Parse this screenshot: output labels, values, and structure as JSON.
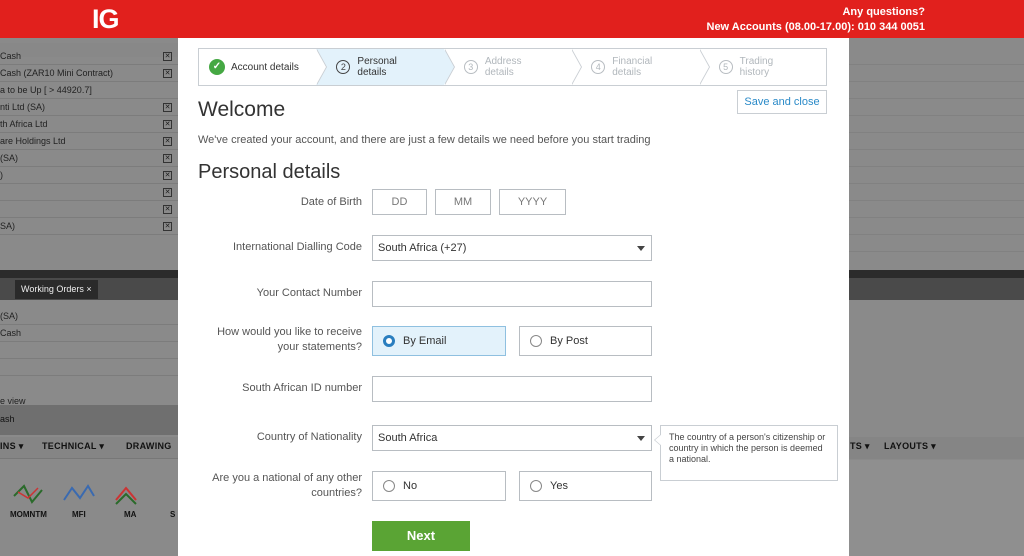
{
  "header": {
    "logo": "IG",
    "contact_line1": "Any questions?",
    "contact_line2": "New Accounts (08.00-17.00): 010 344 0051",
    "bar_color": "#e1201d"
  },
  "background": {
    "rows": [
      "Cash",
      "Cash (ZAR10 Mini Contract)",
      "a to be Up [ > 44920.7]",
      "nti Ltd (SA)",
      "th Africa Ltd",
      "are Holdings Ltd",
      "(SA)",
      ")",
      "",
      "",
      "SA)"
    ],
    "working_orders_tab": "Working Orders ×",
    "lower_rows": [
      "(SA)",
      "Cash",
      "",
      "",
      "",
      "e view"
    ],
    "chart_tab": "ash",
    "toolbar": [
      "INS ▾",
      "TECHNICAL ▾",
      "DRAWING"
    ],
    "toolbar_right": [
      "TS ▾",
      "LAYOUTS ▾"
    ],
    "indicators": [
      "MOMNTM",
      "MFI",
      "MA",
      "S"
    ]
  },
  "steps": [
    {
      "label": "Account details",
      "state": "done"
    },
    {
      "num": "2",
      "label": "Personal details",
      "state": "active"
    },
    {
      "num": "3",
      "label": "Address details",
      "state": "todo"
    },
    {
      "num": "4",
      "label": "Financial details",
      "state": "todo"
    },
    {
      "num": "5",
      "label": "Trading history",
      "state": "todo"
    }
  ],
  "save_close": "Save and close",
  "welcome": "Welcome",
  "intro": "We've created your account, and there are just a few details we need before you start trading",
  "section_title": "Personal details",
  "form": {
    "dob_label": "Date of Birth",
    "dob_day": "DD",
    "dob_month": "MM",
    "dob_year": "YYYY",
    "dialling_label": "International Dialling Code",
    "dialling_value": "South Africa (+27)",
    "contact_label": "Your Contact Number",
    "statements_label_1": "How would you like to receive",
    "statements_label_2": "your statements?",
    "by_email": "By Email",
    "by_post": "By Post",
    "id_label": "South African ID number",
    "nationality_label": "Country of Nationality",
    "nationality_value": "South Africa",
    "other_nat_label_1": "Are you a national of any other",
    "other_nat_label_2": "countries?",
    "no": "No",
    "yes": "Yes",
    "next": "Next"
  },
  "tooltip": "The country of a person's citizenship or country in which the person is deemed a national.",
  "colors": {
    "accent_blue": "#2a8ac8",
    "active_step": "#e3f2fb",
    "next_green": "#5aa434",
    "check_green": "#45a843"
  }
}
